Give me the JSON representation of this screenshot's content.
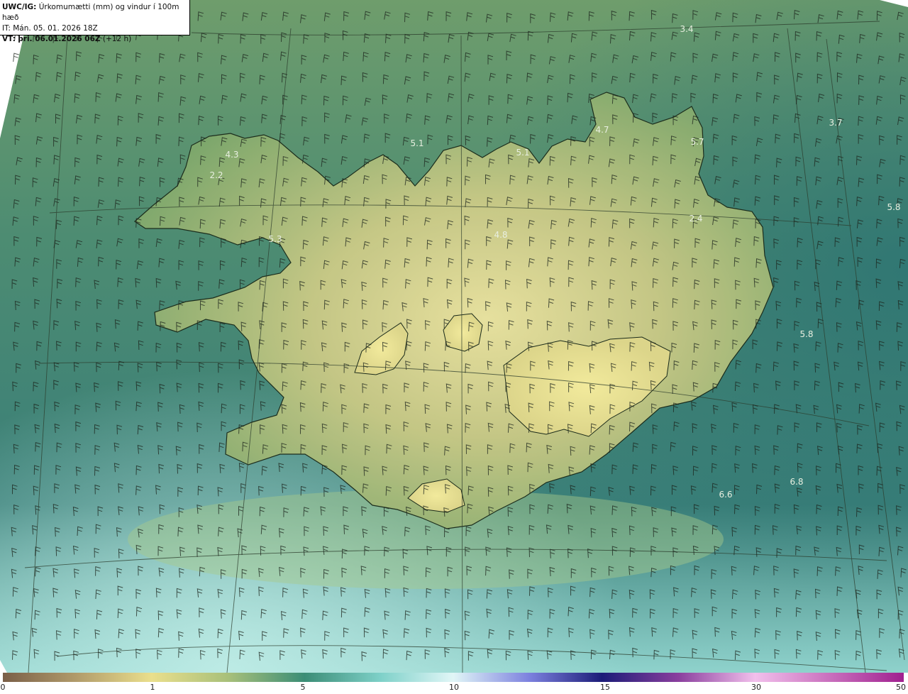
{
  "header": {
    "model": "UWC/IG:",
    "product": "Úrkomumætti (mm) og vindur í 100m hæð",
    "init_time": "IT: Mán. 05. 01. 2026 18Z",
    "valid_prefix": "VT:",
    "valid_time": "þri. 06.01.2026 06Z",
    "lead": "(+12 h)"
  },
  "labels": [
    {
      "text": "3.4"
    },
    {
      "text": "3.7"
    },
    {
      "text": "5.1"
    },
    {
      "text": "5.1"
    },
    {
      "text": "4.7"
    },
    {
      "text": "5.7"
    },
    {
      "text": "4.3"
    },
    {
      "text": "2.2"
    },
    {
      "text": "5.3"
    },
    {
      "text": "4.8"
    },
    {
      "text": "2.4"
    },
    {
      "text": "5.8"
    },
    {
      "text": "5.8"
    },
    {
      "text": "6.6"
    },
    {
      "text": "6.8"
    }
  ],
  "colorbar": {
    "ticks": [
      "0",
      "1",
      "5",
      "10",
      "15",
      "30",
      "50"
    ],
    "colors": [
      "#8a6f55",
      "#b8a070",
      "#e9e18e",
      "#9fbf72",
      "#3f8f7a",
      "#7fd0c8",
      "#d8f4f6",
      "#6a6ad6",
      "#202080",
      "#a04aa8",
      "#f0b0e8",
      "#a0208f"
    ]
  },
  "colors": {
    "sea": "#3f8872",
    "land_low": "#6e9a66",
    "land_high": "#e3dd8a",
    "coast": "#1a2a1a"
  }
}
